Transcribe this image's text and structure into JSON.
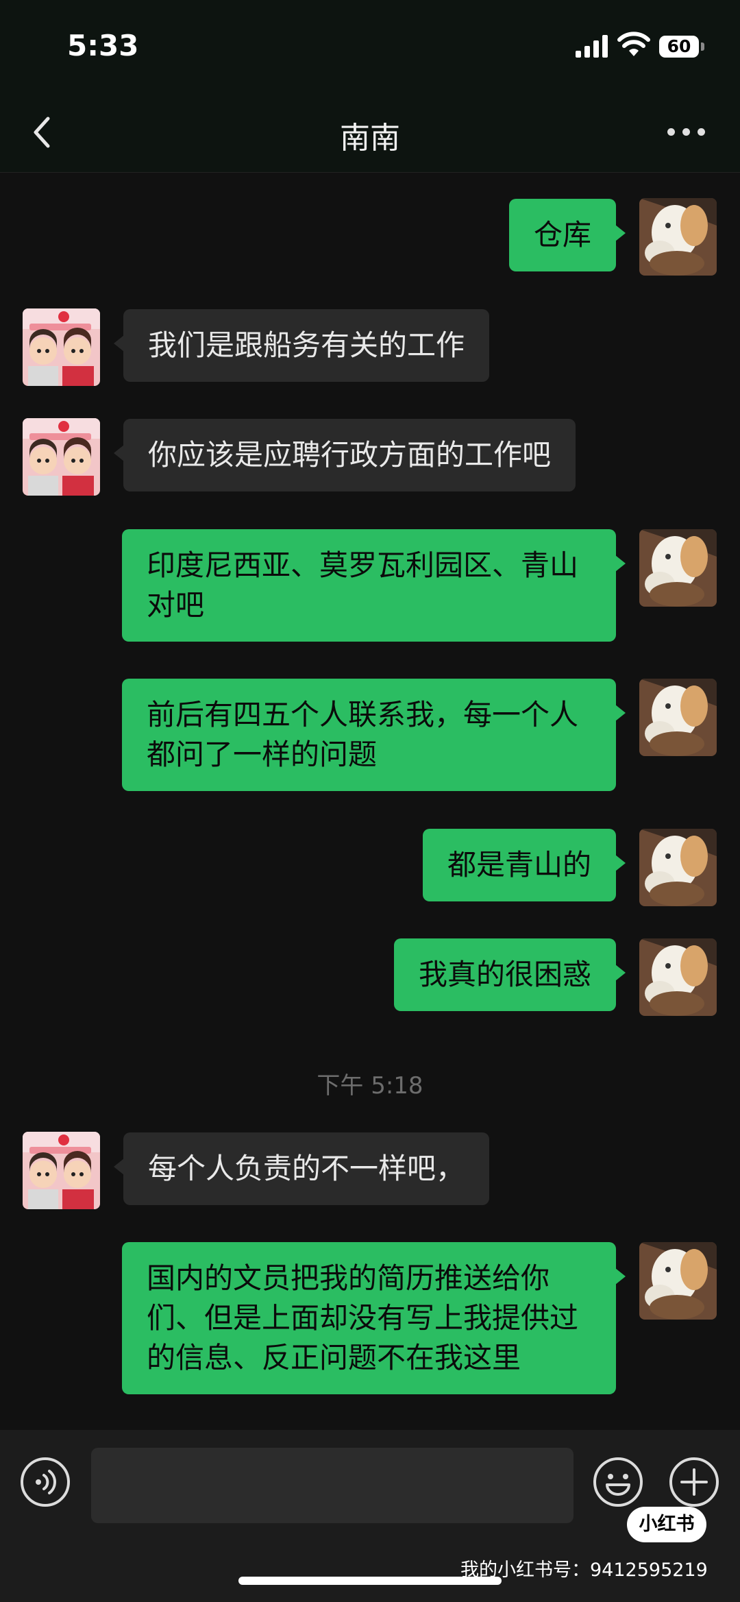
{
  "status_bar": {
    "time": "5:33",
    "battery": "60"
  },
  "header": {
    "title": "南南"
  },
  "messages": [
    {
      "from": "me",
      "text": "仓库"
    },
    {
      "from": "them",
      "text": "我们是跟船务有关的工作"
    },
    {
      "from": "them",
      "text": "你应该是应聘行政方面的工作吧"
    },
    {
      "from": "me",
      "text": "印度尼西亚、莫罗瓦利园区、青山对吧"
    },
    {
      "from": "me",
      "text": "前后有四五个人联系我，每一个人都问了一样的问题"
    },
    {
      "from": "me",
      "text": "都是青山的"
    },
    {
      "from": "me",
      "text": "我真的很困惑"
    },
    {
      "from": "them",
      "text": "每个人负责的不一样吧，"
    },
    {
      "from": "me",
      "text": "国内的文员把我的简历推送给你们、但是上面却没有写上我提供过的信息、反正问题不在我这里"
    }
  ],
  "timestamp": "下午 5:18",
  "watermark": {
    "logo": "小红书",
    "text": "我的小红书号：9412595219"
  },
  "colors": {
    "sent_bubble": "#2bbd62",
    "received_bubble": "#2a2a2a",
    "background": "#111111"
  }
}
